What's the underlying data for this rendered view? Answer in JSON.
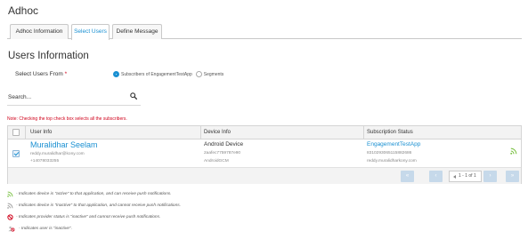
{
  "page": {
    "title": "Adhoc"
  },
  "tabs": [
    {
      "label": "Adhoc Information"
    },
    {
      "label": "Select Users"
    },
    {
      "label": "Define Message"
    }
  ],
  "section": {
    "title": "Users Information"
  },
  "select_users": {
    "label": "Select Users From",
    "required_mark": "*",
    "options": [
      {
        "label": "Subscribers of EngagementTestApp",
        "selected": true
      },
      {
        "label": "Segments",
        "selected": false
      }
    ]
  },
  "search": {
    "placeholder": "Search...",
    "value": ""
  },
  "note": "Note: Checking the top check box selects all the subscribers.",
  "table": {
    "headers": [
      "User Info",
      "Device Info",
      "Subscription Status"
    ],
    "rows": [
      {
        "checked": true,
        "user_name": "Muralidhar Seelam",
        "user_email": "reddy.muralidhar@kony.com",
        "user_phone": "+14078033255",
        "device_title": "Android Device",
        "device_id": "2aafec7759787e90",
        "device_type": "AndroidGCM",
        "app_name": "EngagementTestApp",
        "app_id": "8310293065115882686",
        "app_user": "reddy.muralidharkony.com",
        "status_icon": "signal-active-icon"
      }
    ]
  },
  "pagination": {
    "first": "«",
    "prev": "‹",
    "range": "1 - 1 of 1",
    "next": "›",
    "last": "»"
  },
  "legend": [
    {
      "icon": "signal-active-icon",
      "text": "- Indicates device is \"active\" to that application, and can receive push notifications."
    },
    {
      "icon": "signal-inactive-icon",
      "text": "- Indicates device is \"inactive\" to that application, and cannot receive push notifications."
    },
    {
      "icon": "no-entry-icon",
      "text": "- Indicates provider status is \"inactive\" and cannot receive push notifications."
    },
    {
      "icon": "user-inactive-icon",
      "text": "- Indicates user is \"inactive\"."
    }
  ],
  "colors": {
    "accent": "#1a90d2",
    "required": "#d0021b",
    "active_green": "#7ac143",
    "inactive_gray": "#9a9a9a",
    "no_entry_red": "#d0021b",
    "pager_button": "#c6d9ea"
  }
}
